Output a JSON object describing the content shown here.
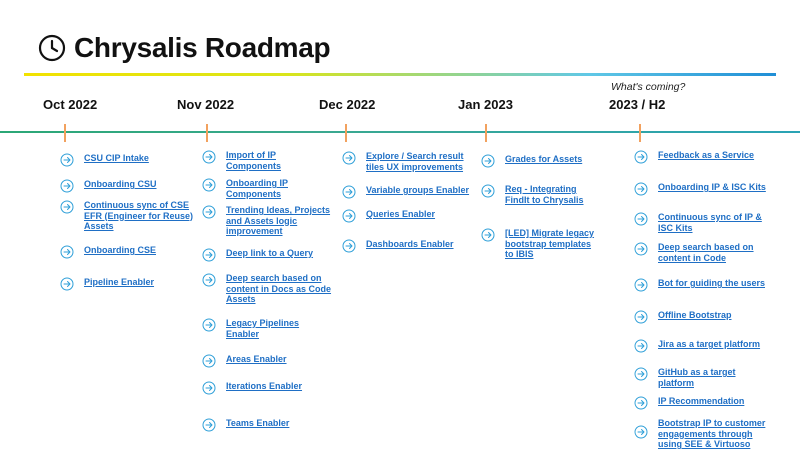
{
  "title": "Chrysalis Roadmap",
  "icons": {
    "title": "clock-icon",
    "item": "circle-arrow-right-icon"
  },
  "colors": {
    "link": "#1f6fc5",
    "tick": "#f2a15e",
    "arrow": "#2e9fd8",
    "timeline": "#2ba776"
  },
  "whats_coming": "What's coming?",
  "months": [
    "Oct 2022",
    "Nov 2022",
    "Dec 2022",
    "Jan 2023",
    "2023 / H2"
  ],
  "columns": {
    "oct": [
      "CSU CIP Intake",
      "Onboarding CSU",
      "Continuous sync of CSE EFR (Engineer for Reuse) Assets",
      "Onboarding CSE",
      "Pipeline Enabler"
    ],
    "nov": [
      "Import of IP Components",
      "Onboarding IP Components",
      "Trending Ideas, Projects and Assets logic improvement",
      "Deep link to a Query",
      "Deep search based on content in Docs as Code Assets",
      "Legacy Pipelines Enabler",
      "Areas Enabler",
      "Iterations Enabler",
      "Teams Enabler"
    ],
    "dec": [
      "Explore / Search result tiles UX improvements",
      "Variable groups Enabler",
      "Queries Enabler",
      "Dashboards Enabler"
    ],
    "jan": [
      "Grades for Assets",
      "Req - Integrating FindIt to Chrysalis",
      "[LED] Migrate legacy bootstrap templates to IBIS"
    ],
    "h2": [
      "Feedback as a Service",
      "Onboarding IP & ISC Kits",
      "Continuous sync of IP & ISC Kits",
      "Deep search based on content in Code",
      "Bot for guiding the users",
      "Offline Bootstrap",
      "Jira as a target platform",
      "GitHub as a target platform",
      "IP Recommendation",
      "Bootstrap IP to customer engagements through using SEE & Virtuoso"
    ]
  }
}
